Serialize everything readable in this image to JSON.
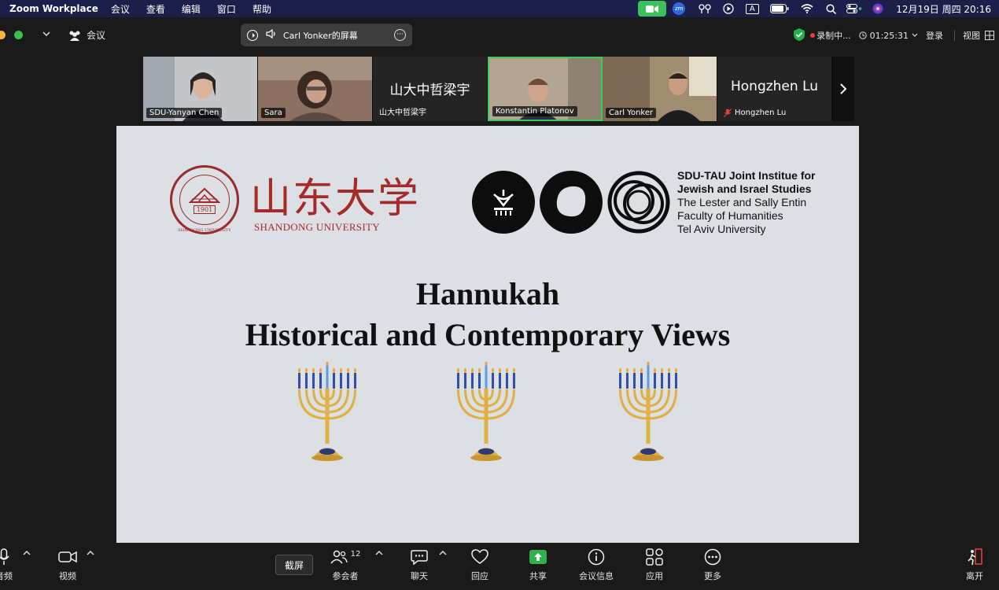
{
  "menubar": {
    "app_name": "Zoom Workplace",
    "items": [
      "会议",
      "查看",
      "编辑",
      "窗口",
      "帮助"
    ],
    "zm_label": "zm",
    "input_label": "A",
    "clock": "12月19日 周四  20:16"
  },
  "topbar": {
    "meeting_label": "会议",
    "share_title": "Carl Yonker的屏幕",
    "recording_label": "录制中...",
    "timer": "01:25:31",
    "login_label": "登录",
    "view_label": "视图"
  },
  "participants": [
    {
      "name": "SDU-Yanyan Chen",
      "video": true,
      "bg": "#b9bcc2"
    },
    {
      "name": "Sara",
      "video": true,
      "bg": "#8a6b5c"
    },
    {
      "name": "山大中哲梁宇",
      "video": false,
      "big_name": "山大中哲梁宇",
      "bg": "#242424"
    },
    {
      "name": "Konstantin Platonov",
      "video": true,
      "bg": "#a89a88",
      "active": true
    },
    {
      "name": "Carl Yonker",
      "video": true,
      "bg": "#9c8a6e"
    },
    {
      "name": "Hongzhen Lu",
      "video": false,
      "big_name": "Hongzhen Lu",
      "bg": "#242424",
      "muted": true
    }
  ],
  "slide": {
    "sdu_seal_year": "1901",
    "sdu_seal_ring": "SHANDONG UNIVERSITY",
    "sdu_name_cn": "山东大学",
    "sdu_name_en": "SHANDONG UNIVERSITY",
    "tau_lines": [
      {
        "text": "SDU-TAU Joint Institue for",
        "bold": true
      },
      {
        "text": "Jewish and Israel Studies",
        "bold": true
      },
      {
        "text": "The Lester and Sally Entin",
        "bold": false
      },
      {
        "text": "Faculty of Humanities",
        "bold": false
      },
      {
        "text": "Tel Aviv University",
        "bold": false
      }
    ],
    "title_line1": "Hannukah",
    "title_line2": "Historical and Contemporary Views",
    "menorah_count": 3
  },
  "toolbar": {
    "audio_label": "音频",
    "video_label": "视频",
    "participants_label": "参会者",
    "participants_count": "12",
    "chat_label": "聊天",
    "react_label": "回应",
    "share_label": "共享",
    "info_label": "会议信息",
    "apps_label": "应用",
    "more_label": "更多",
    "leave_label": "离开",
    "tooltip": "截屏"
  },
  "colors": {
    "menubar_bg": "#1b1f4a",
    "active_speaker": "#3ccb5a",
    "share_green": "#2fb24c",
    "sdu_red": "#a52b2b"
  }
}
